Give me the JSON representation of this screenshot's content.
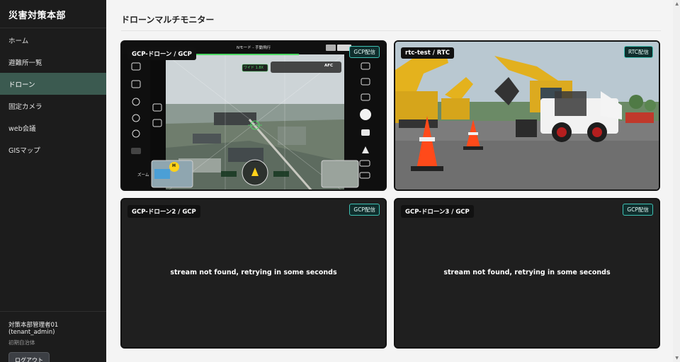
{
  "app": {
    "title": "災害対策本部"
  },
  "sidebar": {
    "items": [
      {
        "label": "ホーム"
      },
      {
        "label": "避難所一覧"
      },
      {
        "label": "ドローン"
      },
      {
        "label": "固定カメラ"
      },
      {
        "label": "web会議"
      },
      {
        "label": "GISマップ"
      }
    ],
    "active": "ドローン"
  },
  "user": {
    "name": "対策本部管理者01 (tenant_admin)",
    "tenant": "初期自治体",
    "logout_label": "ログアウト"
  },
  "page": {
    "title": "ドローンマルチモニター"
  },
  "tiles": [
    {
      "name": "GCP-ドローン / GCP",
      "badge": "GCP配信",
      "message": ""
    },
    {
      "name": "rtc-test / RTC",
      "badge": "RTC配信",
      "message": ""
    },
    {
      "name": "GCP-ドローン2 / GCP",
      "badge": "GCP配信",
      "message": "stream not found, retrying in some seconds"
    },
    {
      "name": "GCP-ドローン3 / GCP",
      "badge": "GCP配信",
      "message": "stream not found, retrying in some seconds"
    }
  ],
  "drone_hud": {
    "mode": "Nモード - 手動飛行",
    "wide_label": "ワイド 1.8X",
    "af_label": "AFC",
    "zoom_label": "ズーム",
    "h_marker": "H"
  },
  "colors": {
    "accent": "#3fc1b4",
    "sidebar_bg": "#1c1c1c",
    "active_nav": "#3b5a50"
  },
  "icons": {
    "scroll_up": "▲",
    "scroll_down": "▼"
  }
}
